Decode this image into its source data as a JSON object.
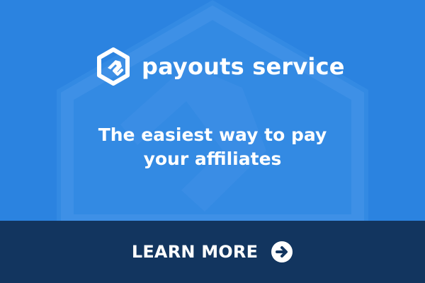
{
  "brand": {
    "name": "payouts service",
    "logo_icon": "hexagon-arrow-icon"
  },
  "tagline": {
    "line_1": "The easiest way to pay",
    "line_2": "your affiliates"
  },
  "cta": {
    "label": "LEARN MORE",
    "icon": "arrow-right-circle-icon"
  },
  "colors": {
    "background": "#2b83e0",
    "background_mark": "#4b96e8",
    "cta_background": "#12355f",
    "text": "#ffffff"
  }
}
